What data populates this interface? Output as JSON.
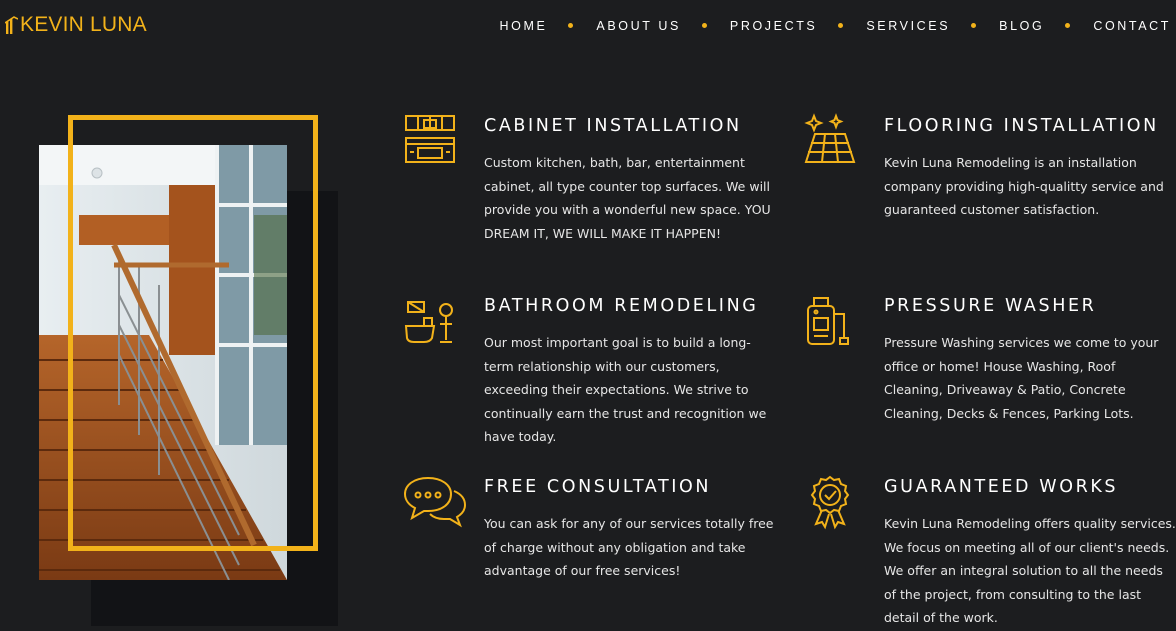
{
  "brand": {
    "name": "KEVIN LUNA",
    "accent_color": "#f2b21a",
    "background_color": "#1c1d1f"
  },
  "nav": {
    "items": [
      {
        "label": "HOME"
      },
      {
        "label": "ABOUT US"
      },
      {
        "label": "PROJECTS"
      },
      {
        "label": "SERVICES"
      },
      {
        "label": "BLOG"
      },
      {
        "label": "CONTACT"
      }
    ]
  },
  "hero_image": {
    "subject": "wooden staircase with glass railing"
  },
  "services": [
    {
      "icon": "kitchen-cabinet-icon",
      "title": "CABINET INSTALLATION",
      "text": "Custom kitchen, bath, bar, entertainment cabinet, all type counter top surfaces. We will provide you with a wonderful new space. YOU DREAM IT, WE WILL MAKE IT HAPPEN!"
    },
    {
      "icon": "flooring-icon",
      "title": "FLOORING INSTALLATION",
      "text": "Kevin Luna Remodeling is an installation company providing high-qualitty service and guaranteed customer satisfaction."
    },
    {
      "icon": "bathroom-icon",
      "title": "BATHROOM REMODELING",
      "text": "Our most important goal is to build a long-term relationship with our customers, exceeding their expectations. We strive to continually earn the trust and recognition we have today."
    },
    {
      "icon": "pressure-washer-icon",
      "title": "PRESSURE WASHER",
      "text": "Pressure Washing services we come to your office or home! House Washing, Roof Cleaning, Driveaway & Patio, Concrete Cleaning, Decks & Fences, Parking Lots."
    },
    {
      "icon": "chat-bubbles-icon",
      "title": "FREE CONSULTATION",
      "text": "You can ask for any of our services totally free of charge without any obligation and take advantage of our free services!"
    },
    {
      "icon": "award-badge-icon",
      "title": "GUARANTEED WORKS",
      "text": "Kevin Luna Remodeling offers quality services. We focus on meeting all of our client's needs. We offer an integral solution to all the needs of the project, from consulting to the last detail of the work."
    }
  ]
}
